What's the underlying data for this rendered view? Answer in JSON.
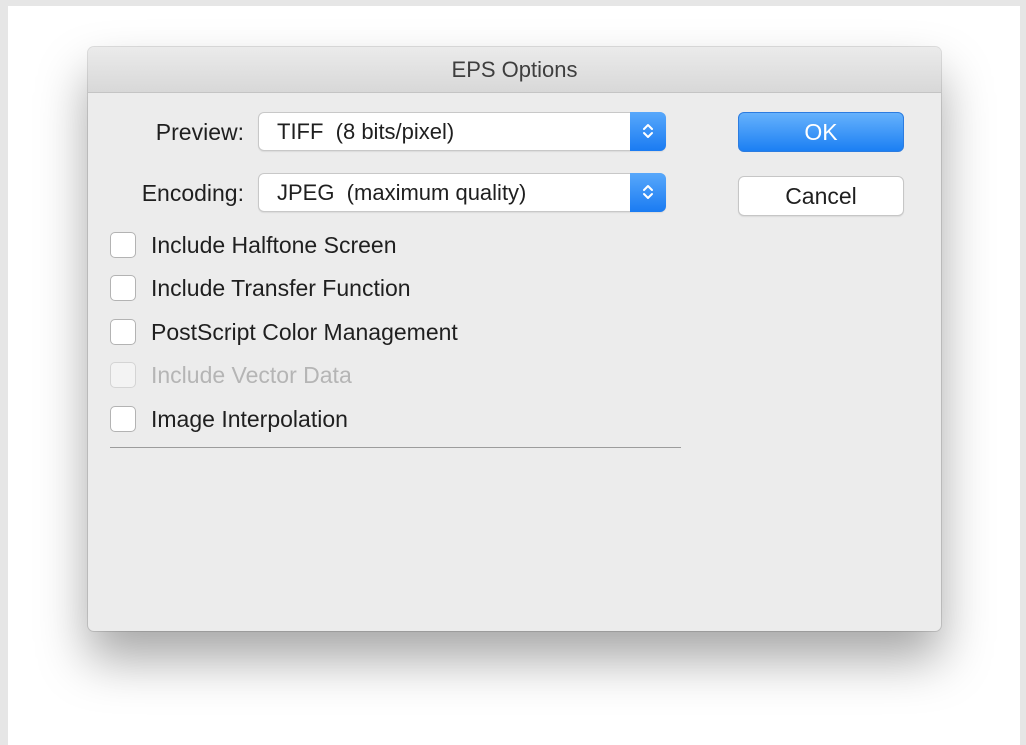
{
  "dialog": {
    "title": "EPS Options",
    "preview": {
      "label": "Preview:",
      "value": "TIFF  (8 bits/pixel)"
    },
    "encoding": {
      "label": "Encoding:",
      "value": "JPEG  (maximum quality)"
    },
    "buttons": {
      "ok": "OK",
      "cancel": "Cancel"
    },
    "options": [
      {
        "label": "Include Halftone Screen",
        "checked": false,
        "enabled": true
      },
      {
        "label": "Include Transfer Function",
        "checked": false,
        "enabled": true
      },
      {
        "label": "PostScript Color Management",
        "checked": false,
        "enabled": true
      },
      {
        "label": "Include Vector Data",
        "checked": false,
        "enabled": false
      },
      {
        "label": "Image Interpolation",
        "checked": false,
        "enabled": true
      }
    ],
    "colors": {
      "accent": "#1b7ff3",
      "background": "#ececec",
      "disabled_text": "#b5b5b5"
    }
  }
}
